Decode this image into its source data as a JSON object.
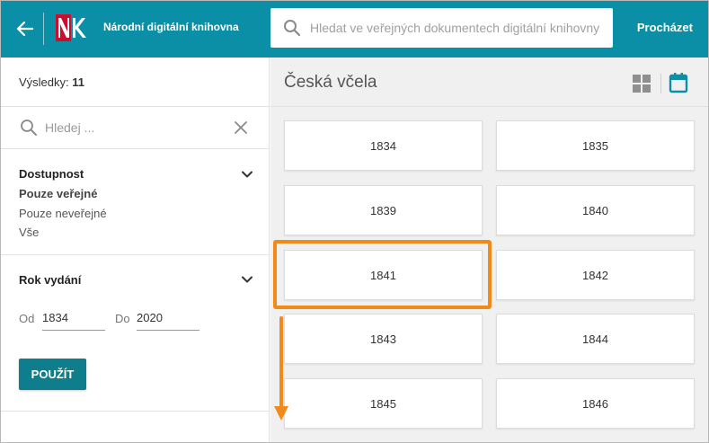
{
  "header": {
    "app_title": "Národní digitální knihovna",
    "search_placeholder": "Hledat ve veřejných dokumentech digitální knihovny",
    "browse_label": "Procházet",
    "logo_text": "NK"
  },
  "sidebar": {
    "results_label": "Výsledky:",
    "results_count": "11",
    "filter_placeholder": "Hledej ...",
    "availability": {
      "title": "Dostupnost",
      "options": [
        "Pouze veřejné",
        "Pouze neveřejné",
        "Vše"
      ]
    },
    "year": {
      "title": "Rok vydání",
      "from_label": "Od",
      "from_value": "1834",
      "to_label": "Do",
      "to_value": "2020",
      "apply_label": "POUŽÍT"
    }
  },
  "main": {
    "title": "Česká včela",
    "years": [
      "1834",
      "1835",
      "1839",
      "1840",
      "1841",
      "1842",
      "1843",
      "1844",
      "1845",
      "1846"
    ]
  },
  "colors": {
    "header_bg": "#0b8fa6",
    "accent": "#0e7d8c",
    "highlight": "#f28a1a",
    "logo_red": "#c8102e"
  }
}
